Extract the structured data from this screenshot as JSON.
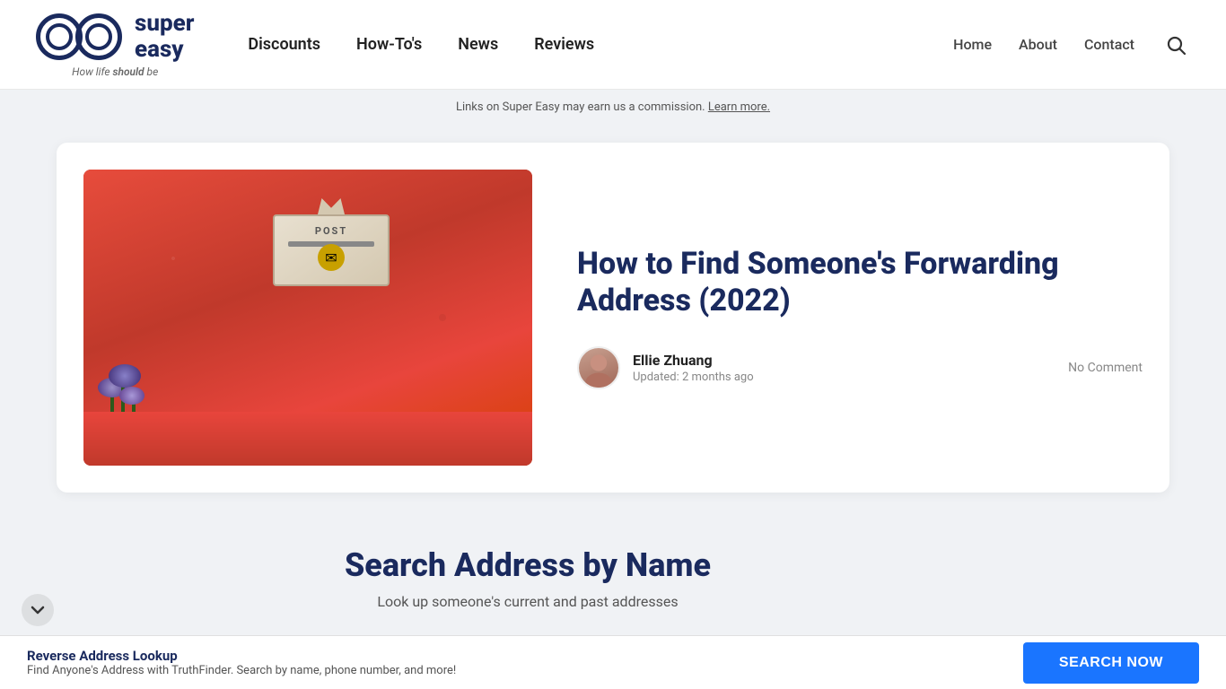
{
  "header": {
    "logo_super": "super",
    "logo_easy": "easy",
    "logo_tagline_prefix": "How life ",
    "logo_tagline_italic": "should",
    "logo_tagline_suffix": " be",
    "primary_nav": [
      {
        "label": "Discounts",
        "href": "#"
      },
      {
        "label": "How-To's",
        "href": "#"
      },
      {
        "label": "News",
        "href": "#"
      },
      {
        "label": "Reviews",
        "href": "#"
      }
    ],
    "secondary_nav": [
      {
        "label": "Home",
        "href": "#"
      },
      {
        "label": "About",
        "href": "#"
      },
      {
        "label": "Contact",
        "href": "#"
      }
    ]
  },
  "commission_bar": {
    "text": "Links on Super Easy may earn us a commission.",
    "learn_more": "Learn more."
  },
  "article": {
    "title": "How to Find Someone's Forwarding Address (2022)",
    "author_name": "Ellie Zhuang",
    "author_updated": "Updated: 2 months ago",
    "comment_count": "No Comment"
  },
  "search_widget": {
    "title": "Search Address by Name",
    "subtitle": "Look up someone's current and past addresses"
  },
  "bottom_bar": {
    "title": "Reverse Address Lookup",
    "subtitle": "Find Anyone's Address with TruthFinder. Search by name, phone number, and more!",
    "button_label": "SEARCH NOW"
  }
}
